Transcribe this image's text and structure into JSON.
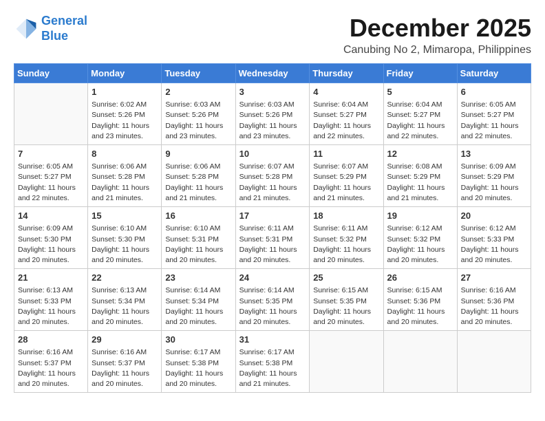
{
  "logo": {
    "line1": "General",
    "line2": "Blue"
  },
  "title": {
    "month_year": "December 2025",
    "location": "Canubing No 2, Mimaropa, Philippines"
  },
  "weekdays": [
    "Sunday",
    "Monday",
    "Tuesday",
    "Wednesday",
    "Thursday",
    "Friday",
    "Saturday"
  ],
  "weeks": [
    [
      {
        "day": "",
        "info": ""
      },
      {
        "day": "1",
        "info": "Sunrise: 6:02 AM\nSunset: 5:26 PM\nDaylight: 11 hours\nand 23 minutes."
      },
      {
        "day": "2",
        "info": "Sunrise: 6:03 AM\nSunset: 5:26 PM\nDaylight: 11 hours\nand 23 minutes."
      },
      {
        "day": "3",
        "info": "Sunrise: 6:03 AM\nSunset: 5:26 PM\nDaylight: 11 hours\nand 23 minutes."
      },
      {
        "day": "4",
        "info": "Sunrise: 6:04 AM\nSunset: 5:27 PM\nDaylight: 11 hours\nand 22 minutes."
      },
      {
        "day": "5",
        "info": "Sunrise: 6:04 AM\nSunset: 5:27 PM\nDaylight: 11 hours\nand 22 minutes."
      },
      {
        "day": "6",
        "info": "Sunrise: 6:05 AM\nSunset: 5:27 PM\nDaylight: 11 hours\nand 22 minutes."
      }
    ],
    [
      {
        "day": "7",
        "info": "Sunrise: 6:05 AM\nSunset: 5:27 PM\nDaylight: 11 hours\nand 22 minutes."
      },
      {
        "day": "8",
        "info": "Sunrise: 6:06 AM\nSunset: 5:28 PM\nDaylight: 11 hours\nand 21 minutes."
      },
      {
        "day": "9",
        "info": "Sunrise: 6:06 AM\nSunset: 5:28 PM\nDaylight: 11 hours\nand 21 minutes."
      },
      {
        "day": "10",
        "info": "Sunrise: 6:07 AM\nSunset: 5:28 PM\nDaylight: 11 hours\nand 21 minutes."
      },
      {
        "day": "11",
        "info": "Sunrise: 6:07 AM\nSunset: 5:29 PM\nDaylight: 11 hours\nand 21 minutes."
      },
      {
        "day": "12",
        "info": "Sunrise: 6:08 AM\nSunset: 5:29 PM\nDaylight: 11 hours\nand 21 minutes."
      },
      {
        "day": "13",
        "info": "Sunrise: 6:09 AM\nSunset: 5:29 PM\nDaylight: 11 hours\nand 20 minutes."
      }
    ],
    [
      {
        "day": "14",
        "info": "Sunrise: 6:09 AM\nSunset: 5:30 PM\nDaylight: 11 hours\nand 20 minutes."
      },
      {
        "day": "15",
        "info": "Sunrise: 6:10 AM\nSunset: 5:30 PM\nDaylight: 11 hours\nand 20 minutes."
      },
      {
        "day": "16",
        "info": "Sunrise: 6:10 AM\nSunset: 5:31 PM\nDaylight: 11 hours\nand 20 minutes."
      },
      {
        "day": "17",
        "info": "Sunrise: 6:11 AM\nSunset: 5:31 PM\nDaylight: 11 hours\nand 20 minutes."
      },
      {
        "day": "18",
        "info": "Sunrise: 6:11 AM\nSunset: 5:32 PM\nDaylight: 11 hours\nand 20 minutes."
      },
      {
        "day": "19",
        "info": "Sunrise: 6:12 AM\nSunset: 5:32 PM\nDaylight: 11 hours\nand 20 minutes."
      },
      {
        "day": "20",
        "info": "Sunrise: 6:12 AM\nSunset: 5:33 PM\nDaylight: 11 hours\nand 20 minutes."
      }
    ],
    [
      {
        "day": "21",
        "info": "Sunrise: 6:13 AM\nSunset: 5:33 PM\nDaylight: 11 hours\nand 20 minutes."
      },
      {
        "day": "22",
        "info": "Sunrise: 6:13 AM\nSunset: 5:34 PM\nDaylight: 11 hours\nand 20 minutes."
      },
      {
        "day": "23",
        "info": "Sunrise: 6:14 AM\nSunset: 5:34 PM\nDaylight: 11 hours\nand 20 minutes."
      },
      {
        "day": "24",
        "info": "Sunrise: 6:14 AM\nSunset: 5:35 PM\nDaylight: 11 hours\nand 20 minutes."
      },
      {
        "day": "25",
        "info": "Sunrise: 6:15 AM\nSunset: 5:35 PM\nDaylight: 11 hours\nand 20 minutes."
      },
      {
        "day": "26",
        "info": "Sunrise: 6:15 AM\nSunset: 5:36 PM\nDaylight: 11 hours\nand 20 minutes."
      },
      {
        "day": "27",
        "info": "Sunrise: 6:16 AM\nSunset: 5:36 PM\nDaylight: 11 hours\nand 20 minutes."
      }
    ],
    [
      {
        "day": "28",
        "info": "Sunrise: 6:16 AM\nSunset: 5:37 PM\nDaylight: 11 hours\nand 20 minutes."
      },
      {
        "day": "29",
        "info": "Sunrise: 6:16 AM\nSunset: 5:37 PM\nDaylight: 11 hours\nand 20 minutes."
      },
      {
        "day": "30",
        "info": "Sunrise: 6:17 AM\nSunset: 5:38 PM\nDaylight: 11 hours\nand 20 minutes."
      },
      {
        "day": "31",
        "info": "Sunrise: 6:17 AM\nSunset: 5:38 PM\nDaylight: 11 hours\nand 21 minutes."
      },
      {
        "day": "",
        "info": ""
      },
      {
        "day": "",
        "info": ""
      },
      {
        "day": "",
        "info": ""
      }
    ]
  ]
}
